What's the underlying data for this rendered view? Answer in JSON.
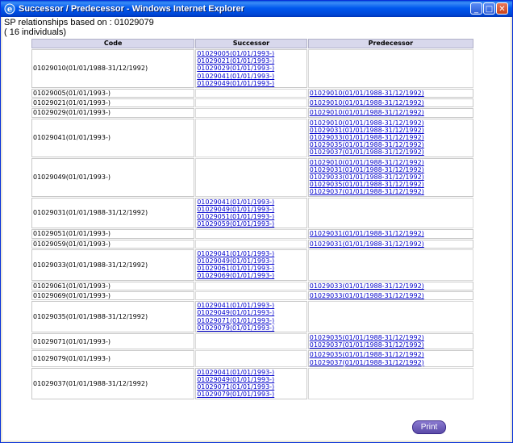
{
  "window": {
    "title": "Successor / Predecessor - Windows Internet Explorer"
  },
  "header": {
    "line1": "SP relationships based on : 01029079",
    "line2": "( 16 individuals)"
  },
  "table": {
    "headers": [
      "Code",
      "Successor",
      "Predecessor"
    ],
    "rows": [
      {
        "code": "01029010(01/01/1988-31/12/1992)",
        "successors": [
          "01029005(01/01/1993-)",
          "01029021(01/01/1993-)",
          "01029029(01/01/1993-)",
          "01029041(01/01/1993-)",
          "01029049(01/01/1993-)"
        ],
        "predecessors": []
      },
      {
        "code": "01029005(01/01/1993-)",
        "successors": [],
        "predecessors": [
          "01029010(01/01/1988-31/12/1992)"
        ]
      },
      {
        "code": "01029021(01/01/1993-)",
        "successors": [],
        "predecessors": [
          "01029010(01/01/1988-31/12/1992)"
        ]
      },
      {
        "code": "01029029(01/01/1993-)",
        "successors": [],
        "predecessors": [
          "01029010(01/01/1988-31/12/1992)"
        ]
      },
      {
        "code": "01029041(01/01/1993-)",
        "successors": [],
        "predecessors": [
          "01029010(01/01/1988-31/12/1992)",
          "01029031(01/01/1988-31/12/1992)",
          "01029033(01/01/1988-31/12/1992)",
          "01029035(01/01/1988-31/12/1992)",
          "01029037(01/01/1988-31/12/1992)"
        ]
      },
      {
        "code": "01029049(01/01/1993-)",
        "successors": [],
        "predecessors": [
          "01029010(01/01/1988-31/12/1992)",
          "01029031(01/01/1988-31/12/1992)",
          "01029033(01/01/1988-31/12/1992)",
          "01029035(01/01/1988-31/12/1992)",
          "01029037(01/01/1988-31/12/1992)"
        ]
      },
      {
        "code": "01029031(01/01/1988-31/12/1992)",
        "successors": [
          "01029041(01/01/1993-)",
          "01029049(01/01/1993-)",
          "01029051(01/01/1993-)",
          "01029059(01/01/1993-)"
        ],
        "predecessors": []
      },
      {
        "code": "01029051(01/01/1993-)",
        "successors": [],
        "predecessors": [
          "01029031(01/01/1988-31/12/1992)"
        ]
      },
      {
        "code": "01029059(01/01/1993-)",
        "successors": [],
        "predecessors": [
          "01029031(01/01/1988-31/12/1992)"
        ]
      },
      {
        "code": "01029033(01/01/1988-31/12/1992)",
        "successors": [
          "01029041(01/01/1993-)",
          "01029049(01/01/1993-)",
          "01029061(01/01/1993-)",
          "01029069(01/01/1993-)"
        ],
        "predecessors": []
      },
      {
        "code": "01029061(01/01/1993-)",
        "successors": [],
        "predecessors": [
          "01029033(01/01/1988-31/12/1992)"
        ]
      },
      {
        "code": "01029069(01/01/1993-)",
        "successors": [],
        "predecessors": [
          "01029033(01/01/1988-31/12/1992)"
        ]
      },
      {
        "code": "01029035(01/01/1988-31/12/1992)",
        "successors": [
          "01029041(01/01/1993-)",
          "01029049(01/01/1993-)",
          "01029071(01/01/1993-)",
          "01029079(01/01/1993-)"
        ],
        "predecessors": []
      },
      {
        "code": "01029071(01/01/1993-)",
        "successors": [],
        "predecessors": [
          "01029035(01/01/1988-31/12/1992)",
          "01029037(01/01/1988-31/12/1992)"
        ]
      },
      {
        "code": "01029079(01/01/1993-)",
        "successors": [],
        "predecessors": [
          "01029035(01/01/1988-31/12/1992)",
          "01029037(01/01/1988-31/12/1992)"
        ]
      },
      {
        "code": "01029037(01/01/1988-31/12/1992)",
        "successors": [
          "01029041(01/01/1993-)",
          "01029049(01/01/1993-)",
          "01029071(01/01/1993-)",
          "01029079(01/01/1993-)"
        ],
        "predecessors": []
      }
    ]
  },
  "print_label": "Print",
  "icons": {
    "window": "ie-logo-icon",
    "min": "minimize-icon",
    "max": "maximize-icon",
    "close": "close-icon"
  },
  "colors": {
    "titlebar": "#0058ee",
    "header_bg": "#d8d8ec",
    "link": "#0000cc",
    "print_button": "#6a5ab8"
  }
}
